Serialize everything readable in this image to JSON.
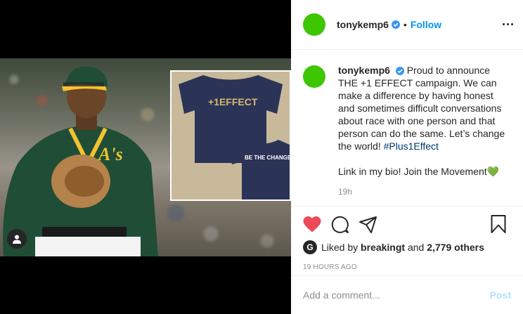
{
  "post": {
    "username": "tonykemp6",
    "follow_label": "Follow",
    "caption_line1": "Proud to announce THE +1 EFFECT campaign. We can make a difference by having honest and sometimes difficult conversations about race with one person and that person can do the same. Let’s change the world!",
    "hashtag": "#Plus1Effect",
    "caption_line2": "Link in my bio! Join the Movement💚",
    "time": "19h",
    "likes_prefix": "Liked by",
    "liker": "breakingt",
    "likes_and": "and",
    "likes_count": "2,779 others",
    "timestamp": "19 HOURS AGO",
    "comment_placeholder": "Add a comment...",
    "post_label": "Post",
    "liker_avatar_letter": "G"
  },
  "media": {
    "shirt_text_1": "+1EFFECT",
    "shirt_text_2": "BE THE CHANGE"
  },
  "colors": {
    "avatar_green": "#3ec600",
    "like_red": "#ed4956",
    "link_blue": "#0095f6",
    "verified_blue": "#3897f0"
  }
}
